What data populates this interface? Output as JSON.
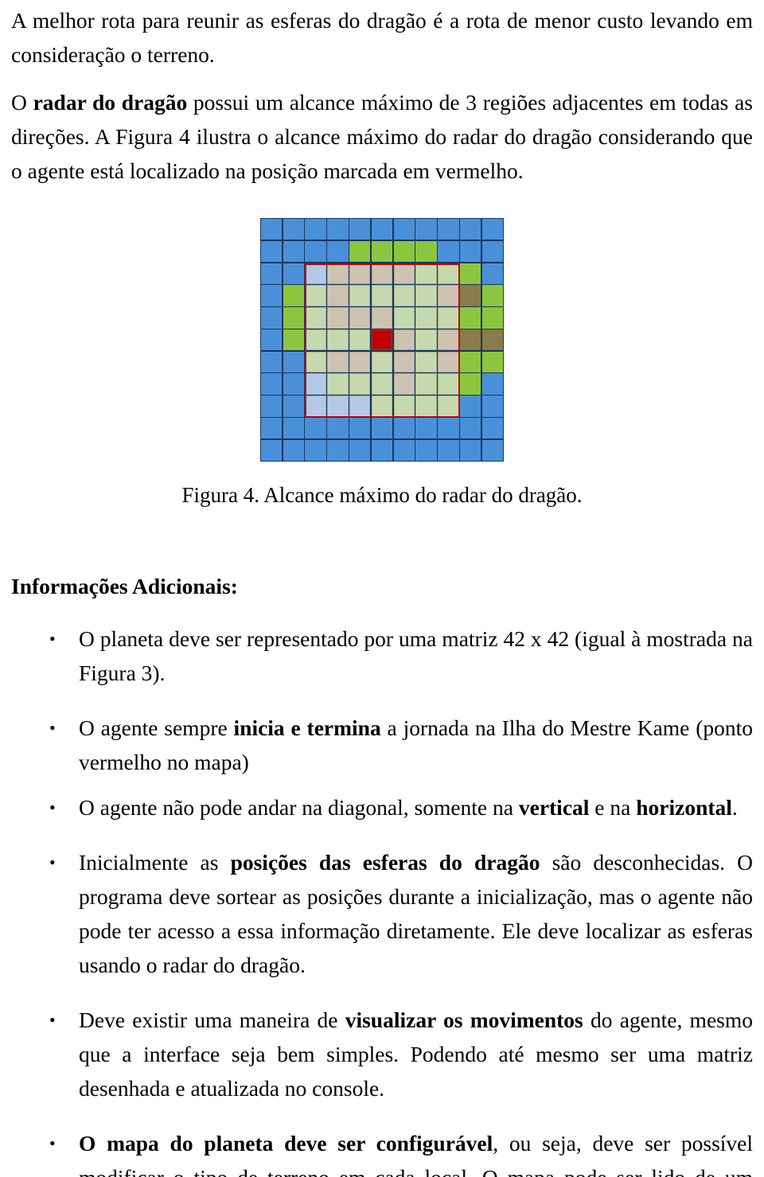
{
  "document": {
    "intro_paragraphs": [
      {
        "id": "p1",
        "runs": [
          {
            "text": "A melhor rota para reunir as esferas do dragão é a rota de menor custo levando em consideração o terreno.",
            "bold": false
          }
        ]
      },
      {
        "id": "p2",
        "runs": [
          {
            "text": "O ",
            "bold": false
          },
          {
            "text": "radar do dragão",
            "bold": true
          },
          {
            "text": " possui um alcance máximo de 3 regiões adjacentes em todas as direções. A Figura 4 ilustra o alcance máximo do radar do dragão considerando que o agente está localizado na posição marcada em vermelho.",
            "bold": false
          }
        ]
      }
    ],
    "figure": {
      "caption": "Figura 4. Alcance máximo do radar do dragão.",
      "legend_colors": {
        "water": "#4a90d9",
        "water_outer": "#5b9bd5",
        "grass_bright": "#8cc63f",
        "grass_light": "#c6d9ae",
        "sand": "#cdc3b0",
        "mountain": "#8a7b4a",
        "shallow_water": "#b3c9e8",
        "agent": "#c00000",
        "radar_border": "#c00000",
        "grid_line": "#17365d"
      }
    },
    "section": {
      "heading": "Informações Adicionais:",
      "bullet_marker": "•"
    },
    "bullets": [
      {
        "id": "b1",
        "runs": [
          {
            "text": "O planeta deve ser representado por uma matriz 42 x 42 (igual à mostrada na Figura 3).",
            "bold": false
          }
        ]
      },
      {
        "id": "b2",
        "runs": [
          {
            "text": "O agente sempre ",
            "bold": false
          },
          {
            "text": "inicia e termina",
            "bold": true
          },
          {
            "text": " a jornada na Ilha do Mestre Kame (ponto vermelho no mapa)",
            "bold": false
          }
        ]
      },
      {
        "id": "b3",
        "runs": [
          {
            "text": "O agente não pode andar na diagonal, somente na ",
            "bold": false
          },
          {
            "text": "vertical",
            "bold": true
          },
          {
            "text": " e na ",
            "bold": false
          },
          {
            "text": "horizontal",
            "bold": true
          },
          {
            "text": ".",
            "bold": false
          }
        ]
      },
      {
        "id": "b4",
        "runs": [
          {
            "text": "Inicialmente as ",
            "bold": false
          },
          {
            "text": "posições das esferas do dragão",
            "bold": true
          },
          {
            "text": " são desconhecidas. O programa deve sortear as posições durante a inicialização, mas o agente não pode ter acesso a essa informação diretamente. Ele deve localizar as esferas usando o radar do dragão.",
            "bold": false
          }
        ]
      },
      {
        "id": "b5",
        "runs": [
          {
            "text": "Deve existir uma maneira de ",
            "bold": false
          },
          {
            "text": "visualizar os movimentos",
            "bold": true
          },
          {
            "text": " do agente, mesmo que a interface seja bem simples. Podendo até mesmo ser uma matriz desenhada e atualizada no console.",
            "bold": false
          }
        ]
      },
      {
        "id": "b6",
        "runs": [
          {
            "text": "O mapa do planeta deve ser configurável",
            "bold": true
          },
          {
            "text": ", ou seja, deve ser possível modificar o tipo de terreno em cada local. O mapa pode ser lido de um arquivo de texto ou deve ser facilmente editável no código.",
            "bold": false
          }
        ]
      }
    ]
  },
  "chart_data": {
    "type": "heatmap",
    "title": "Figura 4. Alcance máximo do radar do dragão.",
    "rows": 11,
    "cols": 11,
    "agent_position": {
      "row": 5,
      "col": 5
    },
    "radar_range": 3,
    "radar_rect": {
      "row_start": 2,
      "row_end": 8,
      "col_start": 2,
      "col_end": 8
    },
    "palette": {
      "W": "#4a90d9",
      "w": "#5b9bd5",
      "S": "#b3c9e8",
      "G": "#8cc63f",
      "g": "#c6d9ae",
      "d": "#cdc3b0",
      "M": "#8a7b4a",
      "A": "#c00000"
    },
    "legend": {
      "W": "water",
      "w": "water-outer",
      "S": "shallow-water",
      "G": "grass-bright",
      "g": "grass-light",
      "d": "sand",
      "M": "mountain",
      "A": "agent"
    },
    "cells": [
      [
        "W",
        "W",
        "W",
        "W",
        "W",
        "W",
        "W",
        "W",
        "W",
        "W",
        "W"
      ],
      [
        "W",
        "W",
        "W",
        "W",
        "G",
        "G",
        "G",
        "G",
        "W",
        "W",
        "W"
      ],
      [
        "W",
        "W",
        "S",
        "d",
        "d",
        "d",
        "d",
        "g",
        "g",
        "G",
        "W"
      ],
      [
        "W",
        "G",
        "g",
        "d",
        "g",
        "g",
        "g",
        "g",
        "d",
        "M",
        "G"
      ],
      [
        "W",
        "G",
        "g",
        "d",
        "d",
        "d",
        "g",
        "g",
        "g",
        "G",
        "G"
      ],
      [
        "W",
        "G",
        "g",
        "g",
        "g",
        "A",
        "d",
        "g",
        "d",
        "M",
        "M"
      ],
      [
        "W",
        "W",
        "g",
        "d",
        "d",
        "g",
        "d",
        "g",
        "d",
        "G",
        "G"
      ],
      [
        "W",
        "W",
        "S",
        "g",
        "g",
        "g",
        "d",
        "g",
        "g",
        "G",
        "W"
      ],
      [
        "W",
        "W",
        "S",
        "S",
        "S",
        "g",
        "g",
        "g",
        "g",
        "W",
        "W"
      ],
      [
        "W",
        "W",
        "W",
        "W",
        "W",
        "W",
        "W",
        "W",
        "W",
        "W",
        "W"
      ],
      [
        "W",
        "W",
        "W",
        "W",
        "W",
        "W",
        "W",
        "W",
        "W",
        "W",
        "W"
      ]
    ]
  }
}
